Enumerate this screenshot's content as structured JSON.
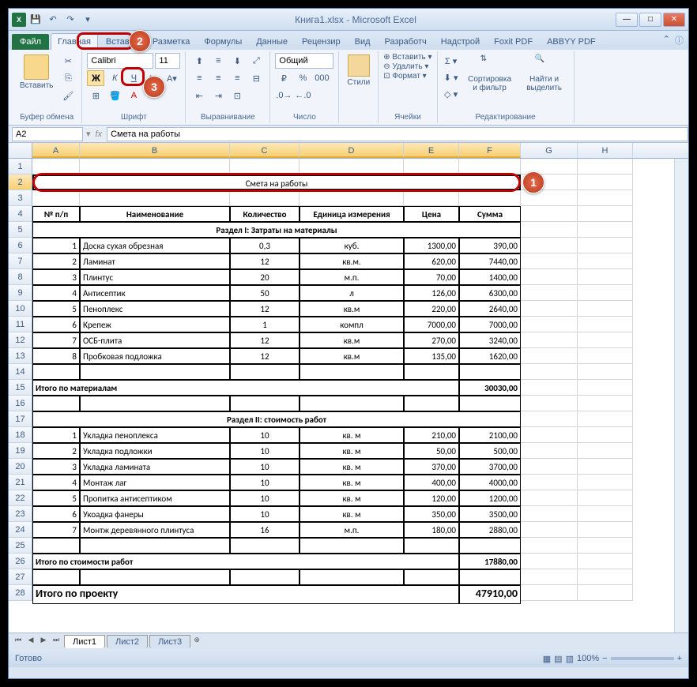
{
  "title": "Книга1.xlsx  -  Microsoft Excel",
  "tabs": [
    "Главная",
    "Вставка",
    "Разметка",
    "Формулы",
    "Данные",
    "Рецензир",
    "Вид",
    "Разработч",
    "Надстрой",
    "Foxit PDF",
    "ABBYY PDF"
  ],
  "file_tab": "Файл",
  "groups": {
    "clipboard": "Буфер обмена",
    "paste": "Вставить",
    "font": "Шрифт",
    "align": "Выравнивание",
    "number": "Число",
    "styles": "Стили",
    "cells": "Ячейки",
    "editing": "Редактирование"
  },
  "font_name": "Calibri",
  "font_size": "11",
  "bold_label": "Ж",
  "italic_label": "К",
  "underline_label": "Ч",
  "number_format": "Общий",
  "cells_btns": {
    "insert": "Вставить",
    "delete": "Удалить",
    "format": "Формат"
  },
  "edit_btns": {
    "sort": "Сортировка и фильтр",
    "find": "Найти и выделить"
  },
  "name_box": "A2",
  "formula": "Смета на работы",
  "columns": [
    "A",
    "B",
    "C",
    "D",
    "E",
    "F",
    "G",
    "H"
  ],
  "sheet": {
    "title_row": "Смета на работы",
    "headers": [
      "№ п/п",
      "Наименование",
      "Количество",
      "Единица измерения",
      "Цена",
      "Сумма"
    ],
    "section1": "Раздел I: Затраты на материалы",
    "rows1": [
      [
        "1",
        "Доска сухая обрезная",
        "0,3",
        "куб.",
        "1300,00",
        "390,00"
      ],
      [
        "2",
        "Ламинат",
        "12",
        "кв.м.",
        "620,00",
        "7440,00"
      ],
      [
        "3",
        "Плинтус",
        "20",
        "м.п.",
        "70,00",
        "1400,00"
      ],
      [
        "4",
        "Антисептик",
        "50",
        "л",
        "126,00",
        "6300,00"
      ],
      [
        "5",
        "Пеноплекс",
        "12",
        "кв.м",
        "220,00",
        "2640,00"
      ],
      [
        "6",
        "Крепеж",
        "1",
        "компл",
        "7000,00",
        "7000,00"
      ],
      [
        "7",
        "ОСБ-плита",
        "12",
        "кв.м",
        "270,00",
        "3240,00"
      ],
      [
        "8",
        "Пробковая подложка",
        "12",
        "кв.м",
        "135,00",
        "1620,00"
      ]
    ],
    "subtotal1_label": "Итого по материалам",
    "subtotal1_value": "30030,00",
    "section2": "Раздел II: стоимость работ",
    "rows2": [
      [
        "1",
        "Укладка пеноплекса",
        "10",
        "кв. м",
        "210,00",
        "2100,00"
      ],
      [
        "2",
        "Укладка подложки",
        "10",
        "кв. м",
        "50,00",
        "500,00"
      ],
      [
        "3",
        "Укладка  ламината",
        "10",
        "кв. м",
        "370,00",
        "3700,00"
      ],
      [
        "4",
        "Монтаж лаг",
        "10",
        "кв. м",
        "400,00",
        "4000,00"
      ],
      [
        "5",
        "Пропитка антисептиком",
        "10",
        "кв. м",
        "120,00",
        "1200,00"
      ],
      [
        "6",
        "Укоадка фанеры",
        "10",
        "кв. м",
        "350,00",
        "3500,00"
      ],
      [
        "7",
        "Монтж деревянного плинтуса",
        "16",
        "м.п.",
        "180,00",
        "2880,00"
      ]
    ],
    "subtotal2_label": "Итого по стоимости работ",
    "subtotal2_value": "17880,00",
    "total_label": "Итого по проекту",
    "total_value": "47910,00"
  },
  "sheets": [
    "Лист1",
    "Лист2",
    "Лист3"
  ],
  "status": "Готово",
  "zoom": "100%"
}
